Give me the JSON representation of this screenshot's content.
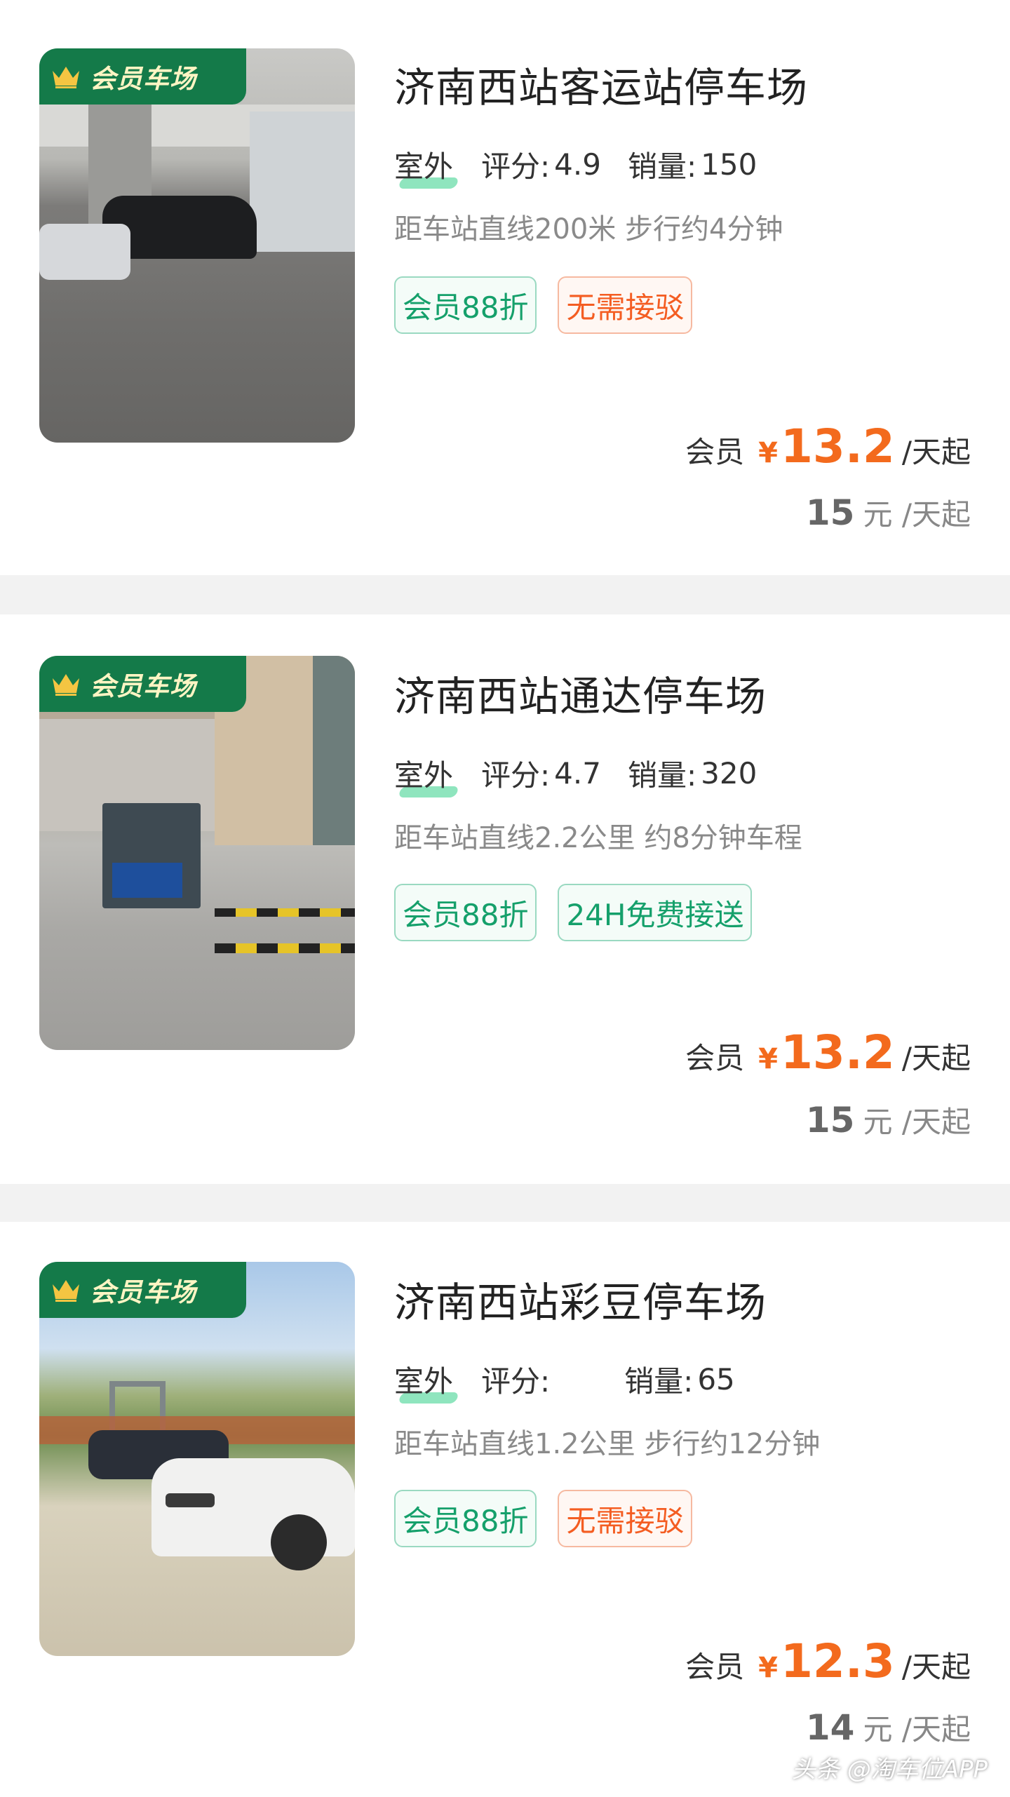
{
  "badge_label": "会员车场",
  "listings": [
    {
      "title": "济南西站客运站停车场",
      "type": "室外",
      "rating_label": "评分:",
      "rating": "4.9",
      "sales_label": "销量:",
      "sales": "150",
      "distance": "距车站直线200米 步行约4分钟",
      "tags": [
        "会员88折",
        "无需接驳"
      ],
      "member_label": "会员",
      "currency": "¥",
      "member_price": "13.2",
      "price_unit": "/天起",
      "regular_price": "15",
      "regular_unit": "元 /天起"
    },
    {
      "title": "济南西站通达停车场",
      "type": "室外",
      "rating_label": "评分:",
      "rating": "4.7",
      "sales_label": "销量:",
      "sales": "320",
      "distance": "距车站直线2.2公里 约8分钟车程",
      "tags": [
        "会员88折",
        "24H免费接送"
      ],
      "member_label": "会员",
      "currency": "¥",
      "member_price": "13.2",
      "price_unit": "/天起",
      "regular_price": "15",
      "regular_unit": "元 /天起"
    },
    {
      "title": "济南西站彩豆停车场",
      "type": "室外",
      "rating_label": "评分:",
      "rating": "",
      "sales_label": "销量:",
      "sales": "65",
      "distance": "距车站直线1.2公里 步行约12分钟",
      "tags": [
        "会员88折",
        "无需接驳"
      ],
      "member_label": "会员",
      "currency": "¥",
      "member_price": "12.3",
      "price_unit": "/天起",
      "regular_price": "14",
      "regular_unit": "元 /天起"
    }
  ],
  "watermark": "头条 @淘车位APP",
  "colors": {
    "accent_price": "#f36a1d",
    "badge_bg": "#147a49",
    "tag_green": "#15a06b",
    "tag_orange": "#f45d22"
  },
  "icons": [
    "crown-icon"
  ]
}
